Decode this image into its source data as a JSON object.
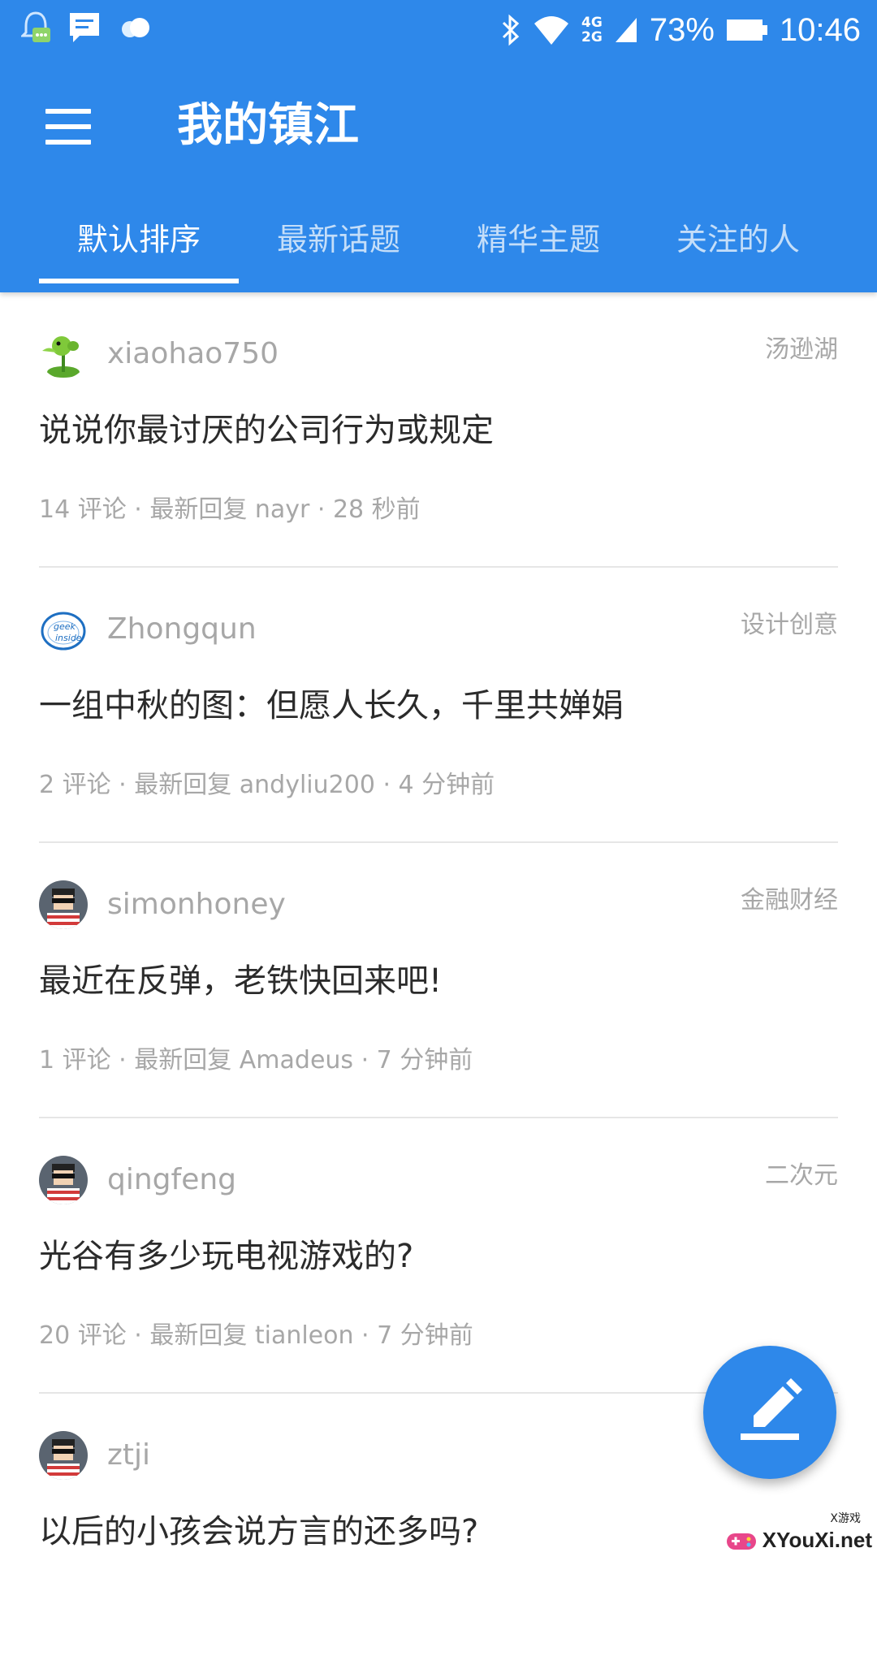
{
  "status_bar": {
    "net_top": "4G",
    "net_bottom": "2G",
    "battery": "73%",
    "time": "10:46",
    "icons": [
      "bell-chat-icon",
      "message-icon",
      "cloud-icon",
      "bluetooth-icon",
      "wifi-icon",
      "signal-icon",
      "battery-icon"
    ]
  },
  "app_bar": {
    "title": "我的镇江",
    "menu_icon": "hamburger-menu-icon"
  },
  "tabs": [
    {
      "label": "默认排序",
      "active": true
    },
    {
      "label": "最新话题",
      "active": false
    },
    {
      "label": "精华主题",
      "active": false
    },
    {
      "label": "关注的人",
      "active": false
    }
  ],
  "topics": [
    {
      "user": "xiaohao750",
      "category": "汤逊湖",
      "title": "说说你最讨厌的公司行为或规定",
      "meta": "14 评论 · 最新回复 nayr · 28 秒前",
      "avatar": "plant-avatar"
    },
    {
      "user": "Zhongqun",
      "category": "设计创意",
      "title": "一组中秋的图：但愿人长久，千里共婵娟",
      "meta": "2 评论 · 最新回复 andyliu200 · 4 分钟前",
      "avatar": "geek-inside-avatar"
    },
    {
      "user": "simonhoney",
      "category": "金融财经",
      "title": "最近在反弹，老铁快回来吧!",
      "meta": "1 评论 · 最新回复 Amadeus · 7 分钟前",
      "avatar": "pixel-sunglasses-avatar"
    },
    {
      "user": "qingfeng",
      "category": "二次元",
      "title": "光谷有多少玩电视游戏的?",
      "meta": "20 评论 · 最新回复 tianleon · 7 分钟前",
      "avatar": "pixel-sunglasses-avatar"
    },
    {
      "user": "ztji",
      "category": "",
      "title": "以后的小孩会说方言的还多吗?",
      "meta": "",
      "avatar": "pixel-sunglasses-avatar"
    }
  ],
  "fab": {
    "icon": "edit-pencil-icon"
  },
  "watermark": {
    "text": "XYouXi.net",
    "small": "X游戏"
  },
  "colors": {
    "primary": "#2e88ea",
    "text_primary": "#2b2b2b",
    "text_secondary": "#a7a7a7",
    "divider": "#e6e6e6"
  }
}
